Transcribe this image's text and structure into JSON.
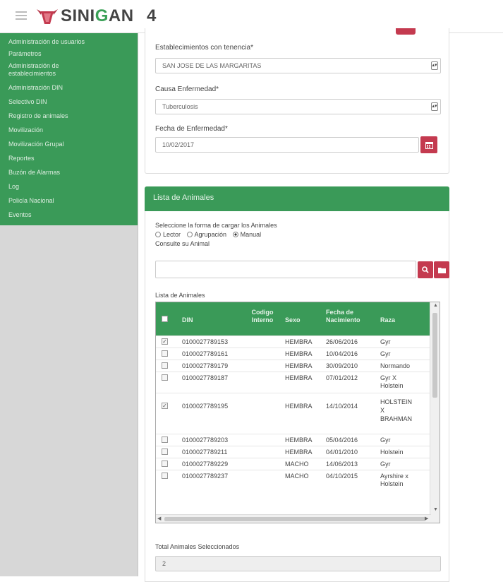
{
  "header": {
    "brand_prefix": "SINI",
    "brand_g": "G",
    "brand_suffix": "AN",
    "version": "4"
  },
  "sidebar": {
    "items": [
      {
        "label": "Administración de usuarios"
      },
      {
        "label": "Parámetros"
      },
      {
        "label": "Administración de establecimientos"
      },
      {
        "label": "Administración DIN"
      },
      {
        "label": "Selectivo DIN"
      },
      {
        "label": "Registro de animales"
      },
      {
        "label": "Movilización"
      },
      {
        "label": "Movilización Grupal"
      },
      {
        "label": "Reportes"
      },
      {
        "label": "Buzón de Alarmas"
      },
      {
        "label": "Log"
      },
      {
        "label": "Policía Nacional"
      },
      {
        "label": "Eventos"
      }
    ]
  },
  "form": {
    "establecimiento_label": "Establecimientos con tenencia*",
    "establecimiento_value": "SAN JOSE DE LAS MARGARITAS",
    "causa_label": "Causa Enfermedad*",
    "causa_value": "Tuberculosis",
    "fecha_label": "Fecha de Enfermedad*",
    "fecha_value": "10/02/2017"
  },
  "animales": {
    "panel_title": "Lista de Animales",
    "forma_label": "Seleccione la forma de cargar los Animales",
    "options": [
      "Lector",
      "Agrupación",
      "Manual"
    ],
    "selected_option": "Manual",
    "consulte_label": "Consulte su Animal",
    "consulte_value": "",
    "lista_label": "Lista de Animales",
    "columns": [
      "DIN",
      "Codigo Interno",
      "Sexo",
      "Fecha de Nacimiento",
      "Raza"
    ],
    "rows": [
      {
        "checked": true,
        "din": "0100027789153",
        "codigo": "",
        "sexo": "HEMBRA",
        "fecha": "26/06/2016",
        "raza": "Gyr"
      },
      {
        "checked": false,
        "din": "0100027789161",
        "codigo": "",
        "sexo": "HEMBRA",
        "fecha": "10/04/2016",
        "raza": "Gyr"
      },
      {
        "checked": false,
        "din": "0100027789179",
        "codigo": "",
        "sexo": "HEMBRA",
        "fecha": "30/09/2010",
        "raza": "Normando"
      },
      {
        "checked": false,
        "din": "0100027789187",
        "codigo": "",
        "sexo": "HEMBRA",
        "fecha": "07/01/2012",
        "raza": "Gyr X Holstein"
      },
      {
        "checked": true,
        "din": "0100027789195",
        "codigo": "",
        "sexo": "HEMBRA",
        "fecha": "14/10/2014",
        "raza": "HOLSTEIN X BRAHMAN"
      },
      {
        "checked": false,
        "din": "0100027789203",
        "codigo": "",
        "sexo": "HEMBRA",
        "fecha": "05/04/2016",
        "raza": "Gyr"
      },
      {
        "checked": false,
        "din": "0100027789211",
        "codigo": "",
        "sexo": "HEMBRA",
        "fecha": "04/01/2010",
        "raza": "Holstein"
      },
      {
        "checked": false,
        "din": "0100027789229",
        "codigo": "",
        "sexo": "MACHO",
        "fecha": "14/06/2013",
        "raza": "Gyr"
      },
      {
        "checked": false,
        "din": "0100027789237",
        "codigo": "",
        "sexo": "MACHO",
        "fecha": "04/10/2015",
        "raza": "Ayrshire x Holstein"
      }
    ],
    "total_label": "Total Animales Seleccionados",
    "total_value": "2"
  },
  "colors": {
    "green": "#3a9a58",
    "red": "#c43a4f",
    "sidebar_bg": "#d7d7d7"
  }
}
